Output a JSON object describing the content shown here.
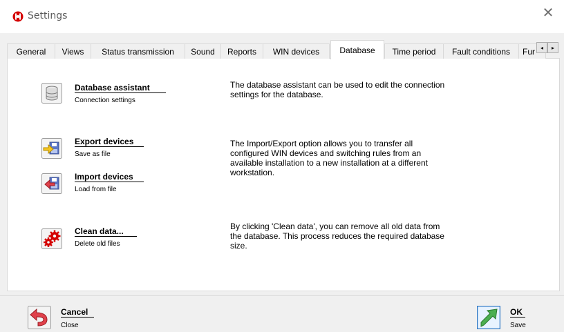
{
  "window": {
    "title": "Settings"
  },
  "tabs": [
    {
      "label": "General"
    },
    {
      "label": "Views"
    },
    {
      "label": "Status transmission"
    },
    {
      "label": "Sound"
    },
    {
      "label": "Reports"
    },
    {
      "label": "WIN devices"
    },
    {
      "label": "Database",
      "active": true
    },
    {
      "label": "Time period"
    },
    {
      "label": "Fault conditions"
    },
    {
      "label": "Fur"
    }
  ],
  "tab_scroll": {
    "left": "◂",
    "right": "▸"
  },
  "database": {
    "assistant": {
      "title": "Database assistant",
      "subtitle": "Connection settings",
      "description": "The database assistant can be used to edit the connection settings for the database."
    },
    "export": {
      "title": "Export devices",
      "subtitle": "Save as file"
    },
    "import": {
      "title": "Import devices",
      "subtitle": "Load from file"
    },
    "import_export_description": "The Import/Export option allows you to transfer all configured WIN devices and switching rules from an available installation to a new installation at a different workstation.",
    "clean": {
      "title": "Clean data...",
      "subtitle": "Delete old files",
      "description": "By clicking 'Clean data', you can remove all old data from the database. This process reduces the required database size."
    }
  },
  "footer": {
    "cancel": {
      "title": "Cancel",
      "subtitle": "Close"
    },
    "ok": {
      "title": "OK",
      "subtitle": "Save"
    }
  },
  "colors": {
    "brand_red": "#d40000",
    "arrow_green": "#4caf50"
  }
}
